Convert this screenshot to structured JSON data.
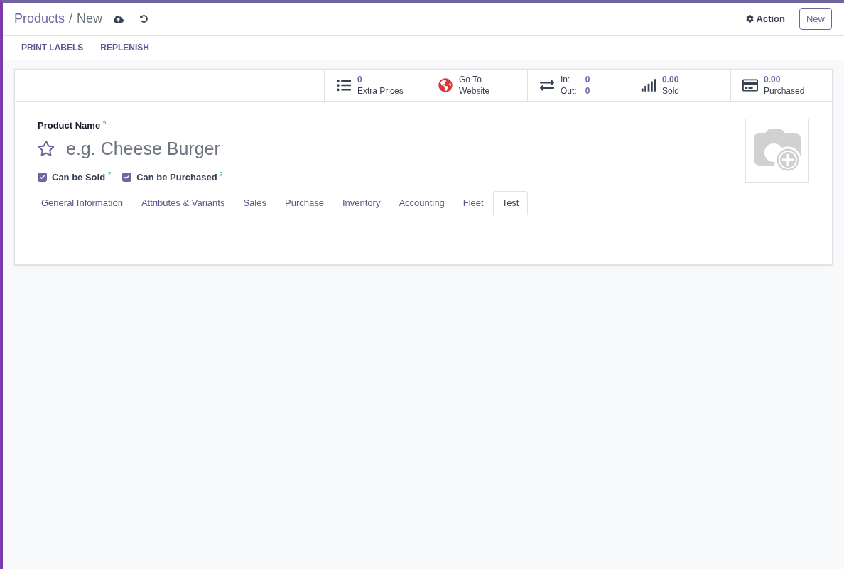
{
  "breadcrumb": {
    "parent": "Products",
    "separator": "/",
    "current": "New"
  },
  "header_actions": {
    "action": "Action",
    "new": "New"
  },
  "toolbar": [
    "PRINT LABELS",
    "REPLENISH"
  ],
  "stat_buttons": [
    {
      "kind": "count",
      "value": "0",
      "label": "Extra Prices"
    },
    {
      "kind": "link",
      "line1": "Go To",
      "line2": "Website"
    },
    {
      "kind": "inout",
      "in_label": "In:",
      "in_value": "0",
      "out_label": "Out:",
      "out_value": "0"
    },
    {
      "kind": "count",
      "value": "0.00",
      "label": "Sold"
    },
    {
      "kind": "count",
      "value": "0.00",
      "label": "Purchased"
    }
  ],
  "product_name": {
    "label": "Product Name",
    "help": "?",
    "placeholder": "e.g. Cheese Burger",
    "favorite": false
  },
  "checkboxes": [
    {
      "label": "Can be Sold",
      "help": "?",
      "checked": true
    },
    {
      "label": "Can be Purchased",
      "help": "?",
      "checked": true
    }
  ],
  "tabs": [
    {
      "label": "General Information",
      "selected": false
    },
    {
      "label": "Attributes & Variants",
      "selected": false
    },
    {
      "label": "Sales",
      "selected": false
    },
    {
      "label": "Purchase",
      "selected": false
    },
    {
      "label": "Inventory",
      "selected": false
    },
    {
      "label": "Accounting",
      "selected": false
    },
    {
      "label": "Fleet",
      "selected": false
    },
    {
      "label": "Test",
      "selected": true
    }
  ]
}
